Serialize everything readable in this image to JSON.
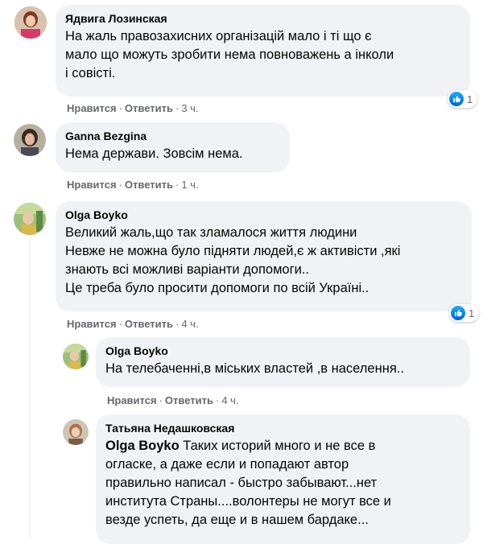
{
  "actions": {
    "like": "Нравится",
    "reply": "Ответить",
    "sep": "·"
  },
  "colors": {
    "bubble": "#f0f2f5",
    "meta": "#65676b",
    "like_blue": "#1877f2"
  },
  "comments": [
    {
      "author": "Ядвига Лозинская",
      "lines": [
        "На жаль правозахисних організацій мало і ті що є",
        "мало що можуть зробити нема повноважень а інколи",
        "і совісті."
      ],
      "time": "3 ч.",
      "reactions": "1"
    },
    {
      "author": "Ganna Bezgina",
      "lines": [
        "Нема держави. Зовсім нема."
      ],
      "time": "1 ч."
    },
    {
      "author": "Olga Boyko",
      "lines": [
        "Великий жаль,що так зламалося життя людини",
        "Невже не можна було підняти людей,є ж активісти ,які",
        "знають всі можливі варіанти допомоги..",
        "Це треба було просити допомоги по всій Україні.."
      ],
      "time": "4 ч.",
      "reactions": "1"
    },
    {
      "author": "Olga Boyko",
      "lines": [
        "На телебаченні,в міських властей ,в населення.."
      ],
      "time": "4 ч."
    },
    {
      "author": "Татьяна Недашковская",
      "mention": "Olga Boyko",
      "first_line_rest": " Таких историй много и не все в",
      "lines": [
        "огласке, а даже если и попадают автор",
        "правильно написал - быстро забывают...нет",
        "института Страны....волонтеры не могут все и",
        "везде успеть, да еще и в нашем бардаке..."
      ]
    }
  ]
}
